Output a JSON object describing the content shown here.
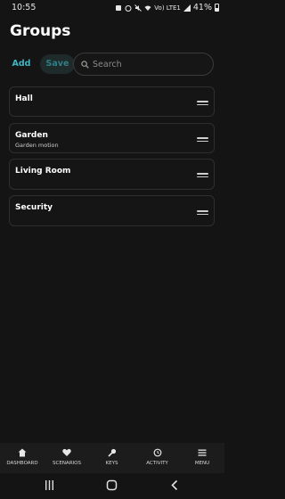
{
  "status_bar": {
    "time": "10:55",
    "network": "Vo) LTE1",
    "battery_percent": "41%"
  },
  "page": {
    "title": "Groups"
  },
  "toolbar": {
    "add_label": "Add",
    "save_label": "Save",
    "search_placeholder": "Search",
    "search_value": ""
  },
  "groups": [
    {
      "name": "Hall",
      "subtitle": ""
    },
    {
      "name": "Garden",
      "subtitle": "Garden motion"
    },
    {
      "name": "Living Room",
      "subtitle": ""
    },
    {
      "name": "Security",
      "subtitle": ""
    }
  ],
  "bottom_nav": [
    {
      "label": "DASHBOARD",
      "icon": "home-icon"
    },
    {
      "label": "SCENARIOS",
      "icon": "heart-icon"
    },
    {
      "label": "KEYS",
      "icon": "key-icon"
    },
    {
      "label": "ACTIVITY",
      "icon": "history-icon"
    },
    {
      "label": "MENU",
      "icon": "menu-icon"
    }
  ],
  "colors": {
    "accent": "#3fb6c6",
    "background": "#141414"
  }
}
